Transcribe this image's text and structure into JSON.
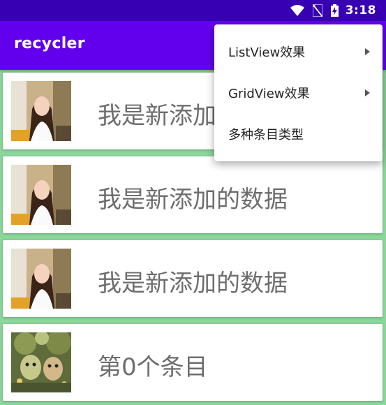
{
  "status_bar": {
    "time": "3:18",
    "icons": [
      "wifi-icon",
      "no-sim-icon",
      "battery-charging-icon"
    ]
  },
  "app_bar": {
    "title": "recycler"
  },
  "list": {
    "items": [
      {
        "title": "我是新添加的数据",
        "image": "girl-photo"
      },
      {
        "title": "我是新添加的数据",
        "image": "girl-photo"
      },
      {
        "title": "我是新添加的数据",
        "image": "girl-photo"
      },
      {
        "title": "第0个条目",
        "image": "cartoon-characters-photo"
      }
    ]
  },
  "overflow_menu": {
    "items": [
      {
        "label": "ListView效果",
        "has_submenu": true
      },
      {
        "label": "GridView效果",
        "has_submenu": true
      },
      {
        "label": "多种条目类型",
        "has_submenu": false
      }
    ]
  },
  "colors": {
    "status_bar": "#3700b3",
    "app_bar": "#6200ee",
    "list_background": "#8bd69b",
    "item_text": "#6d6d6d"
  }
}
